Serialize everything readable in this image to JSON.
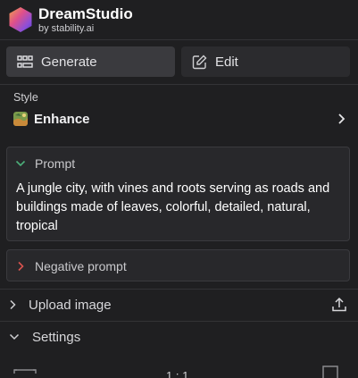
{
  "app": {
    "name": "DreamStudio",
    "subtitle": "by stability.ai",
    "logo_icon": "hexagon-gradient-logo"
  },
  "tabs": [
    {
      "label": "Generate",
      "icon": "grid-icon",
      "active": true
    },
    {
      "label": "Edit",
      "icon": "pencil-square-icon",
      "active": false
    }
  ],
  "style": {
    "label": "Style",
    "value": "Enhance",
    "chevron_icon": "chevron-right-icon"
  },
  "prompt": {
    "label": "Prompt",
    "text": "A jungle city, with vines and roots serving as roads and buildings made of leaves, colorful, detailed, natural, tropical",
    "expanded": true
  },
  "negative_prompt": {
    "label": "Negative prompt",
    "expanded": false
  },
  "upload": {
    "label": "Upload image",
    "icon": "upload-icon"
  },
  "settings": {
    "label": "Settings",
    "expanded": true,
    "aspect_ratio": "1 : 1"
  },
  "colors": {
    "background": "#1f1f21",
    "panel": "#28282b",
    "active_tab": "#3a3a3e",
    "prompt_chevron": "#4caf7a",
    "negative_chevron": "#d9534f"
  }
}
